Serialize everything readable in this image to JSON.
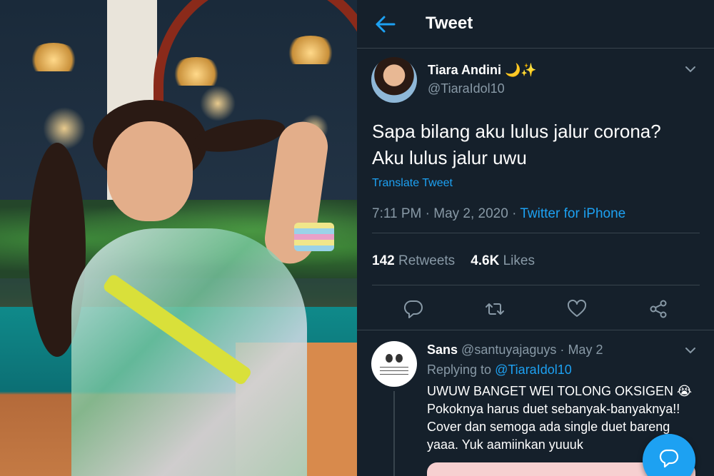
{
  "photo": {
    "alt_subject": ""
  },
  "header": {
    "title": "Tweet"
  },
  "tweet": {
    "author_name": "Tiara Andini 🌙✨",
    "author_handle": "@TiaraIdol10",
    "text_line_1": "Sapa bilang aku lulus jalur corona?",
    "text_line_2": "Aku lulus jalur uwu",
    "translate_label": "Translate Tweet",
    "time": "7:11 PM",
    "dot": "·",
    "date": "May 2, 2020",
    "source": "Twitter for iPhone",
    "retweets_count": "142",
    "retweets_label": "Retweets",
    "likes_count": "4.6K",
    "likes_label": "Likes"
  },
  "reply": {
    "name": "Sans",
    "handle": "@santuyajaguys",
    "date": "May 2",
    "dot": "·",
    "replying_to_label": "Replying to",
    "replying_to_handle": "@TiaraIdol10",
    "lines": [
      "UWUW BANGET WEI TOLONG OKSIGEN 😭",
      "Pokoknya harus duet sebanyak-banyaknya!!",
      "Cover dan semoga ada single duet bareng",
      "yaaa. Yuk aamiinkan yuuuk"
    ]
  },
  "icons": {
    "back": "arrow-left-icon",
    "more": "chevron-down-icon",
    "reply": "comment-icon",
    "retweet": "retweet-icon",
    "like": "heart-icon",
    "share": "share-icon",
    "compose": "compose-reply-icon"
  },
  "colors": {
    "background": "#15202b",
    "accent": "#1da1f2",
    "secondary_text": "#8899a6",
    "divider": "#38444d"
  }
}
